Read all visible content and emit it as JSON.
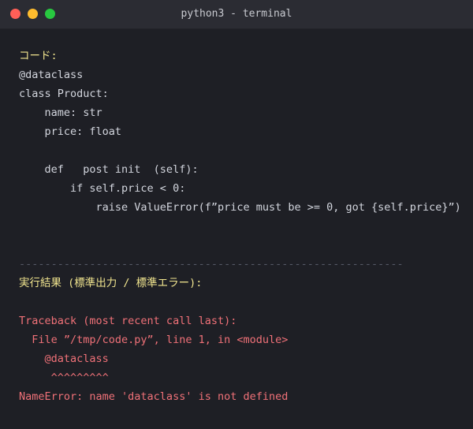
{
  "window": {
    "title": "python3 - terminal"
  },
  "terminal": {
    "code_header": "コード:",
    "code_lines": [
      "@dataclass",
      "class Product:",
      "    name: str",
      "    price: float",
      "",
      "    def   post init  (self):",
      "        if self.price < 0:",
      "            raise ValueError(f”price must be >= 0, got {self.price}”)"
    ],
    "separator": "------------------------------------------------------------",
    "result_header": "実行結果 (標準出力 / 標準エラー):",
    "traceback_lines": [
      "Traceback (most recent call last):",
      "  File ”/tmp/code.py”, line 1, in <module>",
      "    @dataclass",
      "     ^^^^^^^^^"
    ],
    "error_line": "NameError: name 'dataclass' is not defined"
  },
  "colors": {
    "background": "#1e1f25",
    "header": "#f1e58f",
    "code": "#d3d6de",
    "error": "#f07178",
    "separator": "#565a66"
  }
}
